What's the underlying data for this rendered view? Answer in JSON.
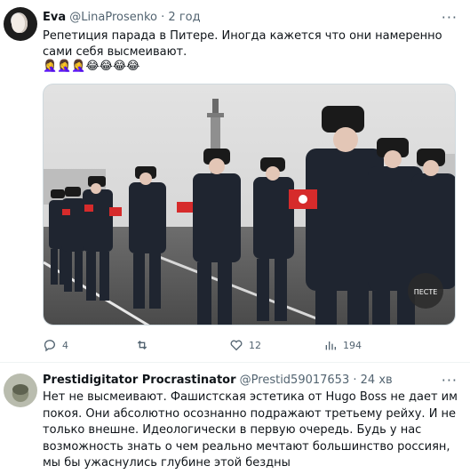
{
  "post": {
    "author_name": "Eva",
    "author_handle": "@LinaProsenko",
    "separator": "·",
    "time": "2 год",
    "more": "···",
    "text": "Репетиция парада в Питере. Иногда кажется что они намеренно сами себя высмеивают.",
    "emojis": "🤦‍♀️🤦‍♀️🤦‍♀️😂😂😂😂",
    "image_watermark": "ПЕСТЕ",
    "actions": {
      "reply": "4",
      "repost": "",
      "like": "12",
      "views": "194"
    }
  },
  "reply": {
    "author_name": "Prestidigitator Procrastinator",
    "author_handle": "@Prestid59017653",
    "separator": "·",
    "time": "24 хв",
    "more": "···",
    "text": "Нет не высмеивают. Фашистская эстетика от Hugo Boss не дает им покоя. Они абсолютно осознанно подражают третьему рейху. И не только внешне. Идеологически в первую очередь. Будь у нас возможность знать о чем реально мечтают большинство россиян, мы бы ужаснулись глубине этой бездны"
  },
  "colors": {
    "text": "#0f1419",
    "secondary": "#536471",
    "divider": "#eff3f4",
    "armband": "#d62b2b"
  },
  "icons": [
    "more-icon",
    "reply-icon",
    "repost-icon",
    "like-icon",
    "views-icon"
  ]
}
